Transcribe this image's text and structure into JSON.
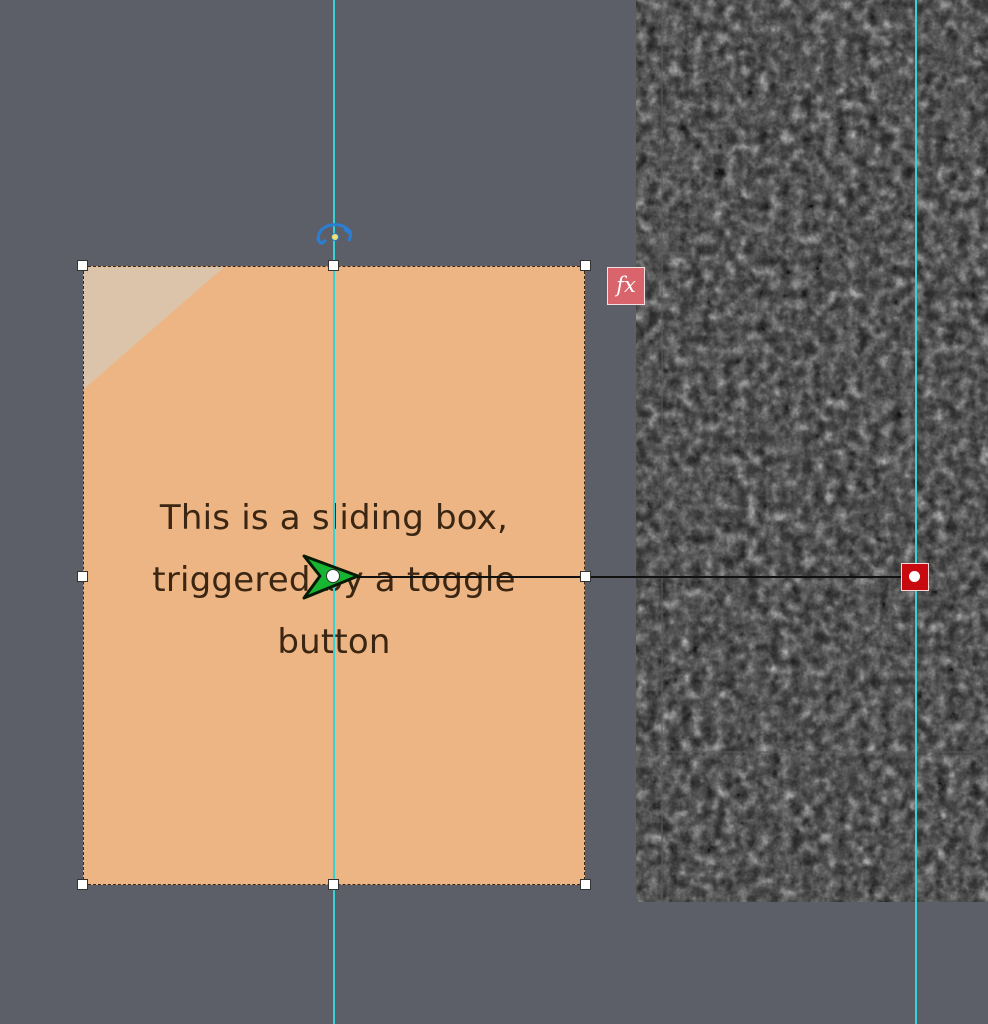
{
  "stage": {
    "background_color": "#5c5f67",
    "texture_color": "#2b2b2b",
    "guide_color": "#36d3d6"
  },
  "sliding_box": {
    "text": "This is a sliding box,\ntriggered by a toggle\nbutton",
    "fill_color": "#edb583",
    "text_color": "#3a2612"
  },
  "effects_badge": {
    "label": "fx",
    "color": "#d9646c"
  },
  "motion_path": {
    "start_marker_icon": "green-arrow-icon",
    "end_marker_icon": "red-square-handle-icon",
    "end_color": "#c8090f"
  },
  "handles": {
    "rotate_icon": "rotate-arrows-icon",
    "resize_icon": "square-handle-icon"
  }
}
